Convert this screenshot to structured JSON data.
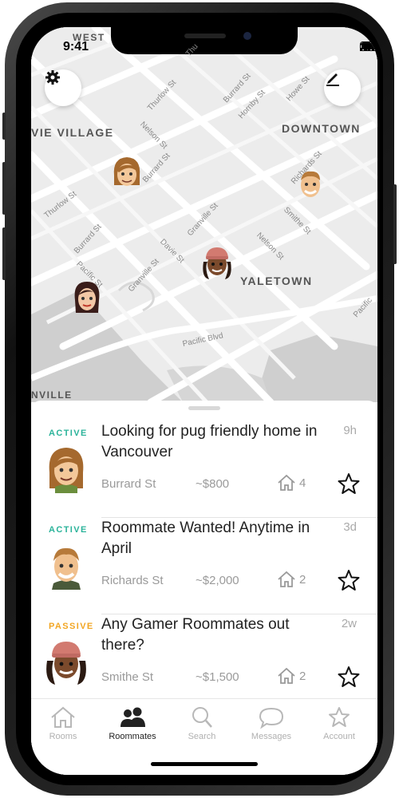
{
  "status_bar": {
    "time": "9:41"
  },
  "map": {
    "area_labels": [
      "WEST",
      "VIE VILLAGE",
      "DOWNTOWN",
      "YALETOWN",
      "NVILLE"
    ],
    "streets": [
      "Thurlow St",
      "Burrard St",
      "Hornby St",
      "Howe St",
      "Nelson St",
      "Burrard St",
      "Richards St",
      "Thurlow St",
      "Granville St",
      "Smithe St",
      "Burrard St",
      "Pacific St",
      "Davie St",
      "Granville St",
      "Nelson St",
      "Pacific Blvd",
      "Pacific",
      "Thu"
    ],
    "settings_icon": "gear-icon",
    "compose_icon": "pen-icon"
  },
  "listings": [
    {
      "status": "ACTIVE",
      "status_color": "#2bb39a",
      "title": "Looking for pug friendly home in Vancouver",
      "age": "9h",
      "street": "Burrard St",
      "price": "~$800",
      "rooms": "4"
    },
    {
      "status": "ACTIVE",
      "status_color": "#2bb39a",
      "title": "Roommate Wanted! Anytime in April",
      "age": "3d",
      "street": "Richards St",
      "price": "~$2,000",
      "rooms": "2"
    },
    {
      "status": "PASSIVE",
      "status_color": "#f2a623",
      "title": "Any Gamer Roommates out there?",
      "age": "2w",
      "street": "Smithe St",
      "price": "~$1,500",
      "rooms": "2"
    }
  ],
  "tabs": [
    {
      "label": "Rooms",
      "icon": "house-icon"
    },
    {
      "label": "Roommates",
      "icon": "people-icon"
    },
    {
      "label": "Search",
      "icon": "search-icon"
    },
    {
      "label": "Messages",
      "icon": "chat-icon"
    },
    {
      "label": "Account",
      "icon": "star-icon"
    }
  ],
  "active_tab": "Roommates"
}
